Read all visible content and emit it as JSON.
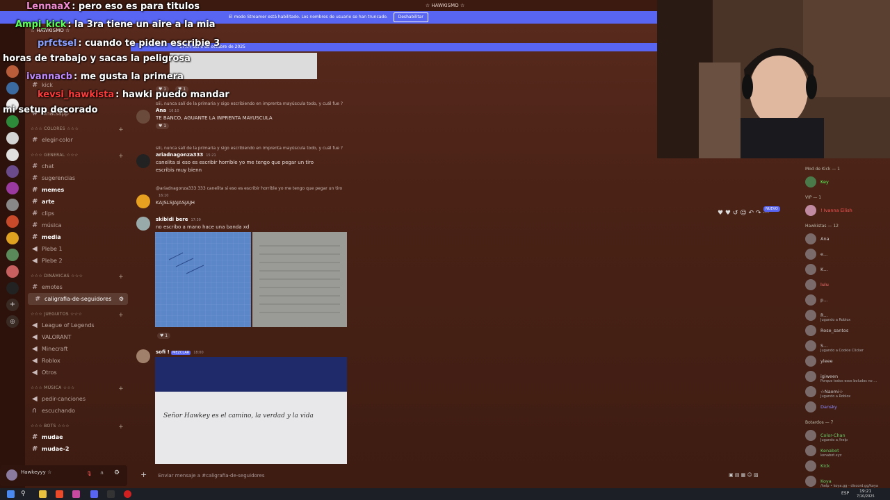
{
  "window": {
    "title": "☆ HAWKISMO ☆"
  },
  "streamer_banner": {
    "text": "El modo Streamer está habilitado. Los nombres de usuario se han truncado.",
    "button": "Deshabilitar"
  },
  "server": {
    "name": "☆ HAWKISMO ☆",
    "current_channel": "caligrafia-de-seguidores"
  },
  "channels": {
    "top": [
      {
        "label": "kick"
      },
      {
        "label": "whatsapp"
      }
    ],
    "categories": [
      {
        "name": "☆☆☆ COLORES ☆☆☆",
        "items": [
          {
            "label": "elegir-color",
            "icon": "#"
          }
        ]
      },
      {
        "name": "☆☆☆ GENERAL ☆☆☆",
        "items": [
          {
            "label": "chat",
            "icon": "#"
          },
          {
            "label": "sugerencias",
            "icon": "#"
          },
          {
            "label": "memes",
            "icon": "#"
          },
          {
            "label": "arte",
            "icon": "#"
          },
          {
            "label": "clips",
            "icon": "#"
          },
          {
            "label": "música",
            "icon": "#"
          },
          {
            "label": "media",
            "icon": "#"
          },
          {
            "label": "Plebe 1",
            "icon": "speaker"
          },
          {
            "label": "Plebe 2",
            "icon": "speaker"
          }
        ]
      },
      {
        "name": "☆☆☆ DINÁMICAS ☆☆☆",
        "items": [
          {
            "label": "emotes",
            "icon": "#"
          },
          {
            "label": "caligrafia-de-seguidores",
            "icon": "#"
          }
        ]
      },
      {
        "name": "☆☆☆ JUEGUITOS ☆☆☆",
        "items": [
          {
            "label": "League of Legends",
            "icon": "speaker"
          },
          {
            "label": "VALORANT",
            "icon": "speaker"
          },
          {
            "label": "Minecraft",
            "icon": "speaker"
          },
          {
            "label": "Roblox",
            "icon": "speaker"
          },
          {
            "label": "Otros",
            "icon": "speaker"
          }
        ]
      },
      {
        "name": "☆☆☆ MÚSICA ☆☆☆",
        "items": [
          {
            "label": "pedir-canciones",
            "icon": "speaker"
          },
          {
            "label": "escuchando",
            "icon": "speaker"
          }
        ]
      },
      {
        "name": "☆☆☆ BOTS ☆☆☆",
        "items": [
          {
            "label": "mudae",
            "icon": "#"
          },
          {
            "label": "mudae-2",
            "icon": "#"
          }
        ]
      }
    ]
  },
  "user": {
    "name": "Hawkeyyy ☆"
  },
  "chat": {
    "date_divider": "17:04 del 6 de octubre de 2025",
    "messages": [
      {
        "reply": "siii, nunca salí de la primaria y sigo escribiendo en imprenta mayúscula todo, y cuál fue ?",
        "author": "Ana",
        "tag": "333",
        "time": "16:10",
        "text": "TE BANCO, AGUANTE LA INPRENTA MAYUSCULA",
        "react": "1"
      },
      {
        "reply": "siii, nunca salí de la primaria y sigo escribiendo en imprenta mayúscula todo, y cuál fue ?",
        "author": "ariadnagonza333",
        "tag": "333",
        "time": "15:21",
        "text": "canelita si eso es escribir horrible yo me tengo que pegar un tiro",
        "text2": "escribis muy bienn"
      },
      {
        "reply": "@ariadnagonza333  333  canelita si eso es escribir horrible yo me tengo que pegar un tiro",
        "author": "",
        "time": "16:10",
        "text": "KAJSLSJAJASJAJH"
      },
      {
        "author": "skibidi bere",
        "time": "17:39",
        "text": "no escribo a mano hace una banda xd",
        "react": "1"
      },
      {
        "author": "sofi !",
        "tag": "MEZCLAR",
        "time": "18:00",
        "text": ""
      }
    ],
    "handwriting": "Señor Hawkey es el camino, la verdad y la vida",
    "input_placeholder": "Enviar mensaje a #caligrafia-de-seguidores",
    "new_badge": "NUEVO"
  },
  "members": {
    "groups": [
      {
        "name": "Mod de Kick — 1",
        "members": [
          {
            "name": "Key",
            "sub": ""
          }
        ]
      },
      {
        "name": "VIP — 1",
        "members": [
          {
            "name": "! Ivanna Eilish",
            "sub": ""
          }
        ]
      },
      {
        "name": "Hawkistas — 12",
        "members": [
          {
            "name": "Ana",
            "sub": ""
          },
          {
            "name": "e...",
            "sub": ""
          },
          {
            "name": "K...",
            "sub": ""
          },
          {
            "name": "lulu",
            "sub": ""
          },
          {
            "name": "p...",
            "sub": ""
          },
          {
            "name": "R...",
            "sub": "Jugando a Roblox"
          },
          {
            "name": "Rose_santos",
            "sub": ""
          },
          {
            "name": "S...",
            "sub": "Jugando a Cookie Clicker"
          },
          {
            "name": "yleee",
            "sub": ""
          },
          {
            "name": "igiween",
            "sub": "Porque todos esos boludos no ..."
          },
          {
            "name": "☆Naomi☆",
            "sub": "Jugando a Roblox"
          },
          {
            "name": "Dansky",
            "sub": ""
          }
        ]
      },
      {
        "name": "Botardos — 7",
        "members": [
          {
            "name": "Color-Chan",
            "sub": "Jugando a /help"
          },
          {
            "name": "Kenabot",
            "sub": "kenabot.xyz"
          },
          {
            "name": "Kick",
            "sub": ""
          },
          {
            "name": "Koya",
            "sub": "/help • koya.gg - discord.gg/koya"
          }
        ]
      }
    ]
  },
  "overlay_chat": [
    {
      "user": "LennaaX",
      "text": ": pero eso es para titulos",
      "color": "#f08ad0"
    },
    {
      "user": "Ampi_kick",
      "text": ": la 3ra tiene un aire a la mia",
      "color": "#5cff5c"
    },
    {
      "user": "prfctsel",
      "text": ": cuando te piden escribie 3",
      "color": "#8aa0ff"
    },
    {
      "user": "",
      "text": "horas de trabajo y sacas la peligrosa",
      "color": "#ffffff"
    },
    {
      "user": "ivannacb",
      "text": ": me gusta la primera",
      "color": "#c08aff"
    },
    {
      "user": "kevsi_hawkista",
      "text": ": hawki puedo mandar",
      "color": "#ff3a3a"
    },
    {
      "user": "",
      "text": "mi setup decorado",
      "color": "#ffffff"
    }
  ],
  "taskbar": {
    "time": "19:21",
    "date": "7/10/2025",
    "lang": "ESP"
  }
}
